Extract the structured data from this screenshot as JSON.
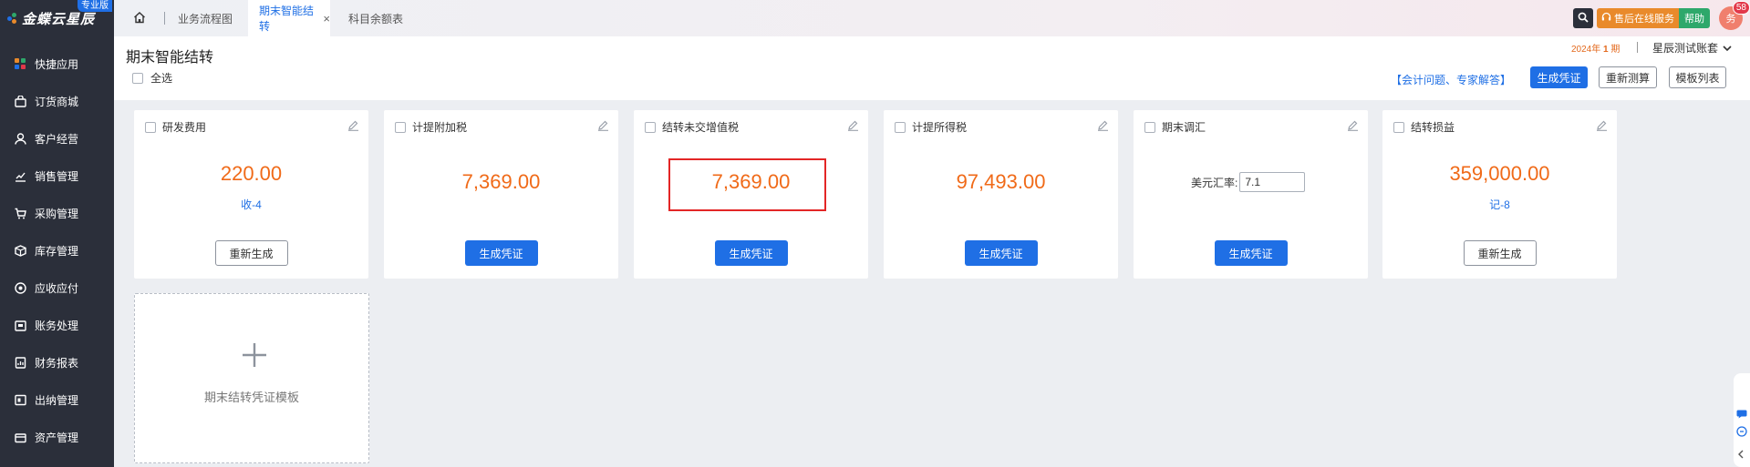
{
  "app": {
    "logo_text": "金蝶云星辰",
    "edition": "专业版"
  },
  "sidebar": {
    "items": [
      {
        "label": "快捷应用",
        "icon": "apps-grid-icon"
      },
      {
        "label": "订货商城",
        "icon": "shopping-bag-icon"
      },
      {
        "label": "客户经营",
        "icon": "customer-icon"
      },
      {
        "label": "销售管理",
        "icon": "sales-chart-icon"
      },
      {
        "label": "采购管理",
        "icon": "cart-icon"
      },
      {
        "label": "库存管理",
        "icon": "box-icon"
      },
      {
        "label": "应收应付",
        "icon": "receivable-icon"
      },
      {
        "label": "账务处理",
        "icon": "ledger-icon"
      },
      {
        "label": "财务报表",
        "icon": "report-icon"
      },
      {
        "label": "出纳管理",
        "icon": "cashier-icon"
      },
      {
        "label": "资产管理",
        "icon": "asset-icon"
      }
    ]
  },
  "tabs": [
    {
      "label": "业务流程图"
    },
    {
      "label": "期末智能结转",
      "active": true
    },
    {
      "label": "科目余额表"
    }
  ],
  "topbar": {
    "service_label": "售后在线服务",
    "help_label": "帮助",
    "avatar_text": "务",
    "badge_count": "58"
  },
  "header": {
    "page_title": "期末智能结转",
    "select_all": "全选",
    "period_year": "2024年",
    "period_num": "1",
    "period_unit": "期",
    "account_set": "星辰测试账套",
    "expert_link": "【会计问题、专家解答】",
    "buttons": {
      "generate": "生成凭证",
      "recalc": "重新测算",
      "template_list": "模板列表"
    }
  },
  "cards": [
    {
      "title": "研发费用",
      "amount": "220.00",
      "sub": "收-4",
      "button": "重新生成"
    },
    {
      "title": "计提附加税",
      "amount": "7,369.00",
      "button": "生成凭证"
    },
    {
      "title": "结转未交增值税",
      "amount": "7,369.00",
      "button": "生成凭证"
    },
    {
      "title": "计提所得税",
      "amount": "97,493.00",
      "button": "生成凭证"
    },
    {
      "title": "期末调汇",
      "rate_label": "美元汇率:",
      "rate_value": "7.1",
      "button": "生成凭证"
    },
    {
      "title": "结转损益",
      "amount": "359,000.00",
      "sub": "记-8",
      "button": "重新生成"
    }
  ],
  "add_card": {
    "label": "期末结转凭证模板"
  },
  "colors": {
    "accent": "#1f6fe5",
    "amount": "#f06a18",
    "sidebar_bg": "#2b2f3a",
    "highlight_border": "#e32626"
  }
}
